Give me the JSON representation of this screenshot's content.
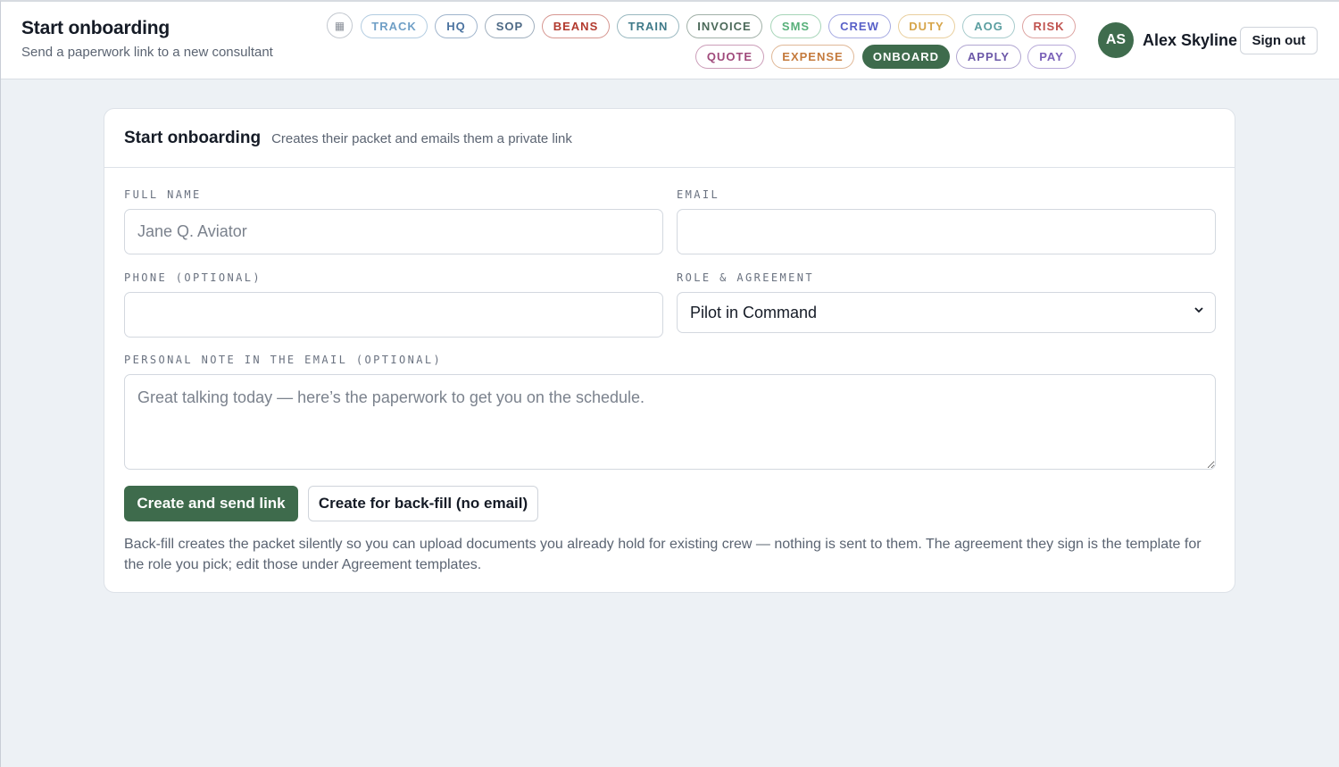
{
  "header": {
    "title": "Start onboarding",
    "subtitle": "Send a paperwork link to a new consultant",
    "grid_icon": "grid-icon",
    "nav": [
      {
        "label": "TRACK",
        "color": "#6f9fc6"
      },
      {
        "label": "HQ",
        "color": "#4b73a0"
      },
      {
        "label": "SOP",
        "color": "#4d6985"
      },
      {
        "label": "BEANS",
        "color": "#b23a2e"
      },
      {
        "label": "TRAIN",
        "color": "#3f7a89"
      },
      {
        "label": "INVOICE",
        "color": "#4c6a5a"
      },
      {
        "label": "SMS",
        "color": "#58b07a"
      },
      {
        "label": "CREW",
        "color": "#5860c8"
      },
      {
        "label": "DUTY",
        "color": "#d6a54a"
      },
      {
        "label": "AOG",
        "color": "#5a9ea0"
      },
      {
        "label": "RISK",
        "color": "#c0524e"
      },
      {
        "label": "QUOTE",
        "color": "#a04a7b"
      },
      {
        "label": "EXPENSE",
        "color": "#c47a3c"
      },
      {
        "label": "ONBOARD",
        "color": "#3e6b4c",
        "active": true
      },
      {
        "label": "APPLY",
        "color": "#6c58a8"
      },
      {
        "label": "PAY",
        "color": "#7a60b8"
      }
    ],
    "user": {
      "initials": "AS",
      "name": "Alex Skyline"
    },
    "sign_out": "Sign out"
  },
  "card": {
    "title": "Start onboarding",
    "description": "Creates their packet and emails them a private link",
    "fields": {
      "full_name": {
        "label": "FULL NAME",
        "placeholder": "Jane Q. Aviator",
        "value": ""
      },
      "email": {
        "label": "EMAIL",
        "placeholder": "",
        "value": ""
      },
      "phone": {
        "label": "PHONE (OPTIONAL)",
        "placeholder": "",
        "value": ""
      },
      "role": {
        "label": "ROLE & AGREEMENT",
        "selected": "Pilot in Command"
      },
      "note": {
        "label": "PERSONAL NOTE IN THE EMAIL (OPTIONAL)",
        "placeholder": "Great talking today — here’s the paperwork to get you on the schedule.",
        "value": ""
      }
    },
    "primary_button": "Create and send link",
    "secondary_button": "Create for back-fill (no email)",
    "help_text": "Back-fill creates the packet silently so you can upload documents you already hold for existing crew — nothing is sent to them. The agreement they sign is the template for the role you pick; edit those under Agreement templates."
  },
  "colors": {
    "accent": "#3e6b4c",
    "background": "#edf1f5"
  }
}
